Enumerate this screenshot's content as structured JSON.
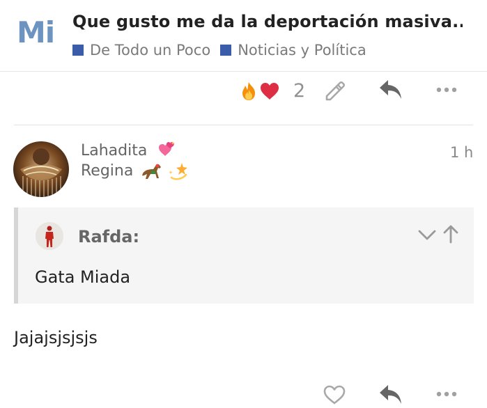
{
  "header": {
    "logo_text": "Mi",
    "topic_title": "Que gusto me da la deportación masiva...",
    "categories": [
      {
        "label": "De Todo un Poco",
        "color": "#3b5ca8"
      },
      {
        "label": "Noticias y Política",
        "color": "#3b5ca8"
      }
    ]
  },
  "previous_post_actions": {
    "reactions": [
      "fire-emoji",
      "red-heart-emoji"
    ],
    "reaction_count": "2",
    "icons": [
      "pencil-edit-icon",
      "reply-icon",
      "more-options-icon"
    ]
  },
  "post": {
    "username": "Lahadita",
    "user_title": "Regina",
    "date": "1 h",
    "quote": {
      "username": "Rafda:",
      "text": "Gata Miada"
    },
    "body": "Jajajsjsjsjs",
    "actions": [
      "heart-like-icon",
      "reply-icon",
      "more-options-icon"
    ]
  },
  "colors": {
    "logo": "#6d94c0",
    "category": "#3b5ca8",
    "muted_text": "#646464",
    "quote_bg": "#f5f5f5",
    "quote_border": "#d6d6d6"
  }
}
